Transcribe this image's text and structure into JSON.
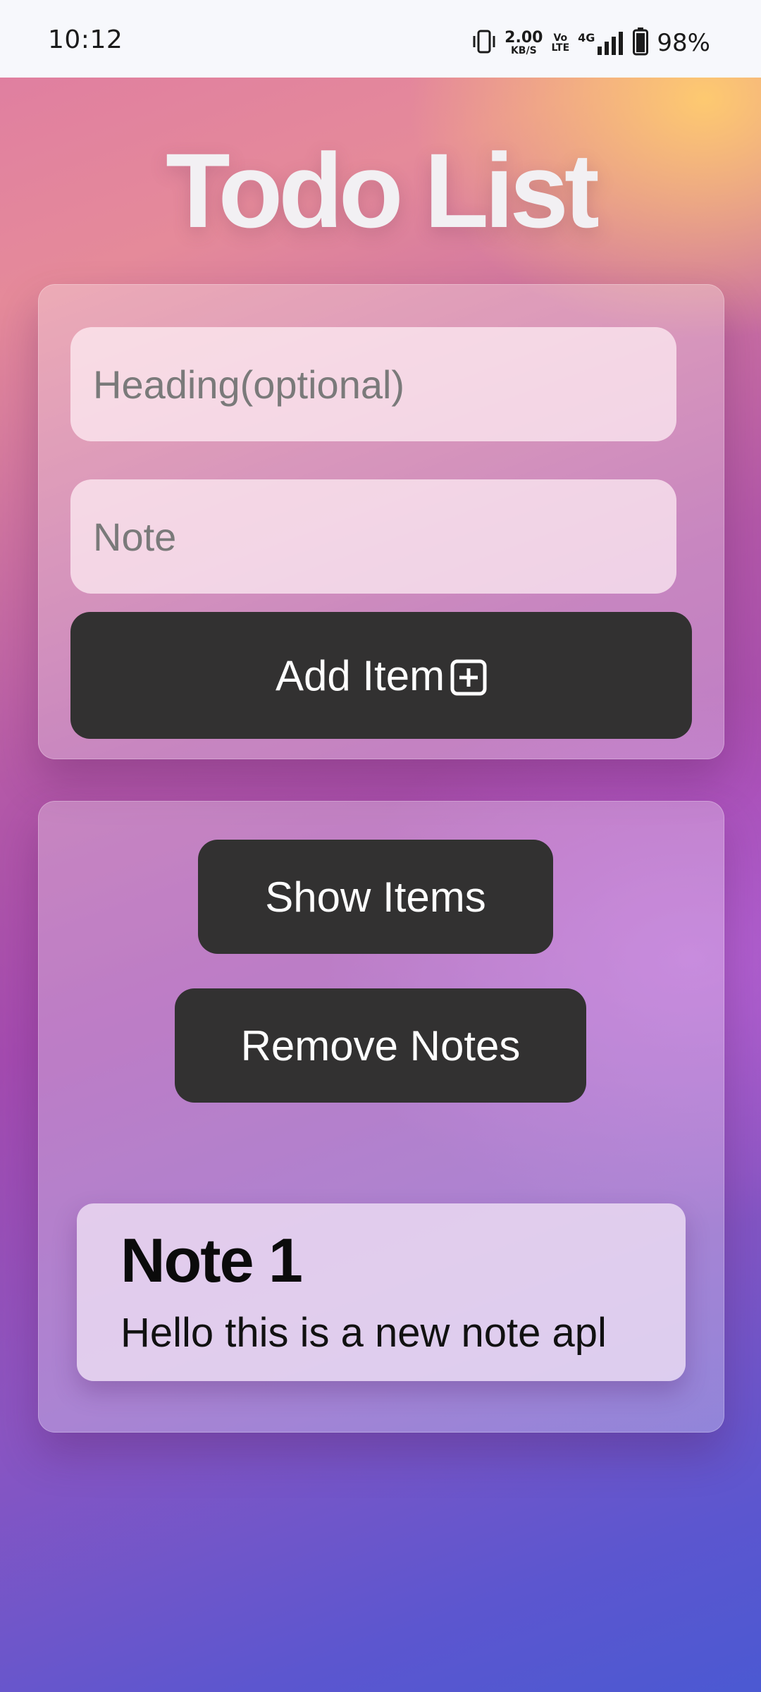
{
  "status_bar": {
    "time": "10:12",
    "speed_value": "2.00",
    "speed_unit": "KB/S",
    "volte_top": "Vo",
    "volte_bottom": "LTE",
    "network": "4G",
    "battery_percent": "98%",
    "icons": [
      "vibrate-icon",
      "signal-icon",
      "battery-icon"
    ]
  },
  "app": {
    "title": "Todo List"
  },
  "form": {
    "heading_placeholder": "Heading(optional)",
    "note_placeholder": "Note",
    "add_button_label": "Add Item",
    "add_button_icon": "plus-box-icon"
  },
  "actions": {
    "show_items_label": "Show Items",
    "remove_notes_label": "Remove Notes"
  },
  "notes": [
    {
      "title": "Note 1",
      "body": "Hello this is a new note apl"
    }
  ],
  "colors": {
    "button_bg": "#323131",
    "button_text": "#ffffff",
    "title_text": "#f2f0f3",
    "gradient_top": "#e07fa0",
    "gradient_mid": "#a44bb0",
    "gradient_bottom": "#4b59d2",
    "accent_yellow": "#ffcd6e"
  }
}
